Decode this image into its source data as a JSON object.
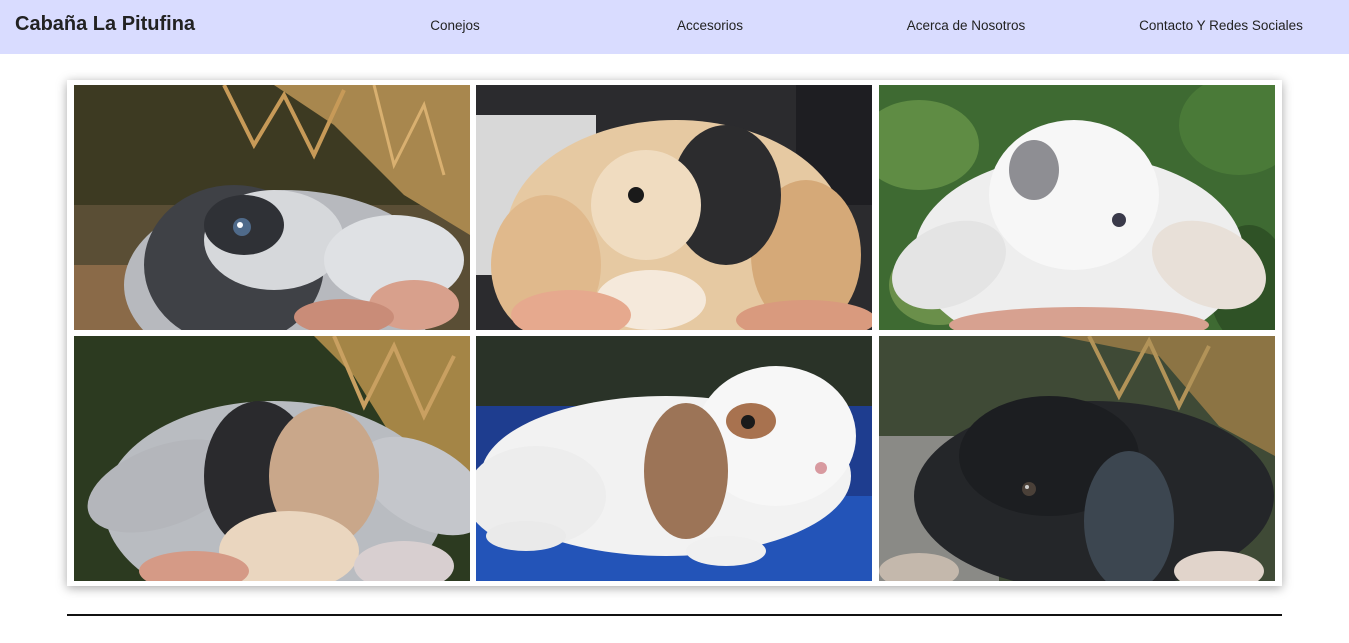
{
  "navbar": {
    "brand": "Cabaña La Pitufina",
    "links": [
      "Conejos",
      "Accesorios",
      "Acerca de Nosotros",
      "Contacto Y Redes Sociales"
    ],
    "background": "#d9dcff"
  },
  "gallery": {
    "photos": [
      {
        "subject": "grey-white-bunny-photo"
      },
      {
        "subject": "cream-black-bunny-photo"
      },
      {
        "subject": "white-bunny-photo"
      },
      {
        "subject": "tricolor-bunny-photo"
      },
      {
        "subject": "white-brown-bunny-photo"
      },
      {
        "subject": "black-bunny-photo"
      }
    ]
  }
}
